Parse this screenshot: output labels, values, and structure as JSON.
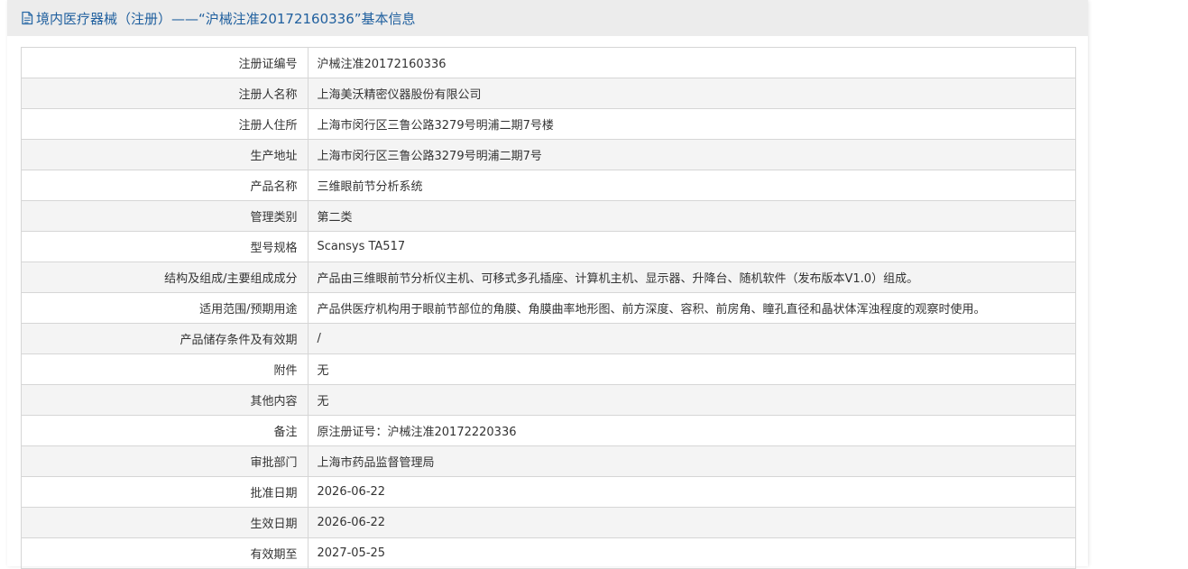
{
  "header": {
    "title": "境内医疗器械（注册）——“沪械注准20172160336”基本信息",
    "icon": "document-icon"
  },
  "rows": [
    {
      "label": "注册证编号",
      "value": "沪械注准20172160336"
    },
    {
      "label": "注册人名称",
      "value": "上海美沃精密仪器股份有限公司"
    },
    {
      "label": "注册人住所",
      "value": "上海市闵行区三鲁公路3279号明浦二期7号楼"
    },
    {
      "label": "生产地址",
      "value": "上海市闵行区三鲁公路3279号明浦二期7号"
    },
    {
      "label": "产品名称",
      "value": "三维眼前节分析系统"
    },
    {
      "label": "管理类别",
      "value": "第二类"
    },
    {
      "label": "型号规格",
      "value": "Scansys TA517"
    },
    {
      "label": "结构及组成/主要组成成分",
      "value": "产品由三维眼前节分析仪主机、可移式多孔插座、计算机主机、显示器、升降台、随机软件（发布版本V1.0）组成。"
    },
    {
      "label": "适用范围/预期用途",
      "value": "产品供医疗机构用于眼前节部位的角膜、角膜曲率地形图、前方深度、容积、前房角、瞳孔直径和晶状体浑浊程度的观察时使用。"
    },
    {
      "label": "产品储存条件及有效期",
      "value": "/"
    },
    {
      "label": "附件",
      "value": "无"
    },
    {
      "label": "其他内容",
      "value": "无"
    },
    {
      "label": "备注",
      "value": "原注册证号：沪械注准20172220336"
    },
    {
      "label": "审批部门",
      "value": "上海市药品监督管理局"
    },
    {
      "label": "批准日期",
      "value": "2026-06-22"
    },
    {
      "label": "生效日期",
      "value": "2026-06-22"
    },
    {
      "label": "有效期至",
      "value": "2027-05-25"
    }
  ],
  "colors": {
    "title": "#1f5f9e",
    "header_bg": "#ececec",
    "alt_row_bg": "#f4f4f4",
    "border": "#d6d6d6"
  }
}
